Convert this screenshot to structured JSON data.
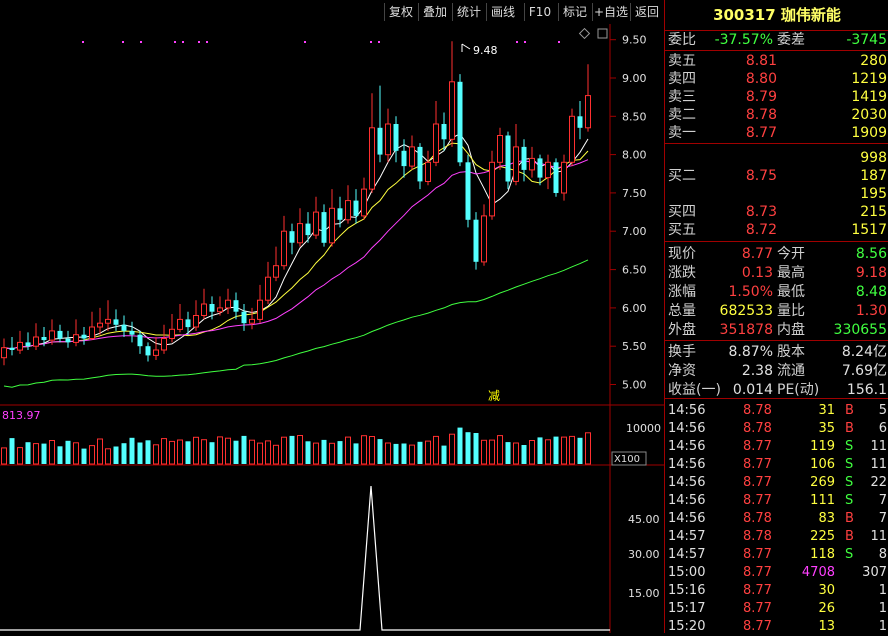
{
  "toolbar": {
    "buttons": [
      "复权",
      "叠加",
      "统计",
      "画线",
      "F10",
      "标记",
      "+自选",
      "返回"
    ]
  },
  "stock": {
    "code": "300317",
    "name": "珈伟新能"
  },
  "quote": {
    "weibi_label": "委比",
    "weibi_value": "-37.57%",
    "weicha_label": "委差",
    "weicha_value": "-3745",
    "sell": [
      {
        "label": "卖五",
        "price": "8.81",
        "vol": "280"
      },
      {
        "label": "卖四",
        "price": "8.80",
        "vol": "1219"
      },
      {
        "label": "卖三",
        "price": "8.79",
        "vol": "1419"
      },
      {
        "label": "卖二",
        "price": "8.78",
        "vol": "2030"
      },
      {
        "label": "卖一",
        "price": "8.77",
        "vol": "1909"
      }
    ],
    "buy": [
      {
        "label": "",
        "price": "",
        "vol": "998"
      },
      {
        "label": "买二",
        "price": "8.75",
        "vol": "187"
      },
      {
        "label": "",
        "price": "",
        "vol": "195"
      },
      {
        "label": "买四",
        "price": "8.73",
        "vol": "215"
      },
      {
        "label": "买五",
        "price": "8.72",
        "vol": "1517"
      }
    ],
    "stats": [
      {
        "l1": "现价",
        "v1": "8.77",
        "l2": "今开",
        "v2": "8.56"
      },
      {
        "l1": "涨跌",
        "v1": "0.13",
        "l2": "最高",
        "v2": "9.18"
      },
      {
        "l1": "涨幅",
        "v1": "1.50%",
        "l2": "最低",
        "v2": "8.48"
      },
      {
        "l1": "总量",
        "v1": "682533",
        "l2": "量比",
        "v2": "1.30"
      },
      {
        "l1": "外盘",
        "v1": "351878",
        "l2": "内盘",
        "v2": "330655"
      }
    ],
    "fund": [
      {
        "l1": "换手",
        "v1": "8.87%",
        "l2": "股本",
        "v2": "8.24亿"
      },
      {
        "l1": "净资",
        "v1": "2.38",
        "l2": "流通",
        "v2": "7.69亿"
      },
      {
        "l1": "收益(一)",
        "v1": "0.014",
        "l2": "PE(动)",
        "v2": "156.1"
      }
    ]
  },
  "ticks": [
    {
      "time": "14:56",
      "price": "8.78",
      "vol": "31",
      "bs": "B",
      "n": "5"
    },
    {
      "time": "14:56",
      "price": "8.78",
      "vol": "35",
      "bs": "B",
      "n": "6"
    },
    {
      "time": "14:56",
      "price": "8.77",
      "vol": "119",
      "bs": "S",
      "n": "11"
    },
    {
      "time": "14:56",
      "price": "8.77",
      "vol": "106",
      "bs": "S",
      "n": "11"
    },
    {
      "time": "14:56",
      "price": "8.77",
      "vol": "269",
      "bs": "S",
      "n": "22"
    },
    {
      "time": "14:56",
      "price": "8.77",
      "vol": "111",
      "bs": "S",
      "n": "7"
    },
    {
      "time": "14:56",
      "price": "8.78",
      "vol": "83",
      "bs": "B",
      "n": "7"
    },
    {
      "time": "14:57",
      "price": "8.78",
      "vol": "225",
      "bs": "B",
      "n": "11"
    },
    {
      "time": "14:57",
      "price": "8.77",
      "vol": "118",
      "bs": "S",
      "n": "8"
    },
    {
      "time": "15:00",
      "price": "8.77",
      "vol": "4708",
      "bs": "",
      "n": "307"
    },
    {
      "time": "15:16",
      "price": "8.77",
      "vol": "30",
      "bs": "",
      "n": "1"
    },
    {
      "time": "15:17",
      "price": "8.77",
      "vol": "26",
      "bs": "",
      "n": "1"
    },
    {
      "time": "15:20",
      "price": "8.77",
      "vol": "13",
      "bs": "",
      "n": "1"
    }
  ],
  "chart_data": {
    "type": "candlestick",
    "price_axis": [
      "9.50",
      "9.00",
      "8.50",
      "8.00",
      "7.50",
      "7.00",
      "6.50",
      "6.00",
      "5.50",
      "5.00"
    ],
    "ylim": [
      4.85,
      9.6
    ],
    "high_marker": "9.48",
    "event_label": "减",
    "volume_label": "813.97",
    "volume_axis": "10000",
    "volume_unit": "X100",
    "indicator_axis": [
      "45.00",
      "30.00",
      "15.00"
    ],
    "candles": [
      [
        5.35,
        5.48,
        5.6,
        5.25
      ],
      [
        5.48,
        5.45,
        5.62,
        5.38
      ],
      [
        5.45,
        5.55,
        5.7,
        5.4
      ],
      [
        5.55,
        5.5,
        5.68,
        5.45
      ],
      [
        5.5,
        5.62,
        5.8,
        5.45
      ],
      [
        5.62,
        5.58,
        5.75,
        5.5
      ],
      [
        5.58,
        5.7,
        5.85,
        5.52
      ],
      [
        5.7,
        5.6,
        5.78,
        5.55
      ],
      [
        5.6,
        5.55,
        5.7,
        5.48
      ],
      [
        5.55,
        5.65,
        5.85,
        5.5
      ],
      [
        5.65,
        5.6,
        5.75,
        5.52
      ],
      [
        5.6,
        5.75,
        5.95,
        5.58
      ],
      [
        5.75,
        5.8,
        6.0,
        5.65
      ],
      [
        5.8,
        5.85,
        6.1,
        5.7
      ],
      [
        5.85,
        5.78,
        5.98,
        5.7
      ],
      [
        5.78,
        5.7,
        5.9,
        5.62
      ],
      [
        5.7,
        5.65,
        5.82,
        5.55
      ],
      [
        5.65,
        5.5,
        5.7,
        5.4
      ],
      [
        5.5,
        5.38,
        5.55,
        5.3
      ],
      [
        5.38,
        5.45,
        5.62,
        5.32
      ],
      [
        5.45,
        5.6,
        5.78,
        5.4
      ],
      [
        5.6,
        5.72,
        5.92,
        5.55
      ],
      [
        5.72,
        5.85,
        6.05,
        5.68
      ],
      [
        5.85,
        5.75,
        5.95,
        5.65
      ],
      [
        5.75,
        5.9,
        6.1,
        5.7
      ],
      [
        5.9,
        6.05,
        6.25,
        5.85
      ],
      [
        6.05,
        5.95,
        6.15,
        5.85
      ],
      [
        5.95,
        6.0,
        6.15,
        5.9
      ],
      [
        6.0,
        6.1,
        6.25,
        5.92
      ],
      [
        6.1,
        5.95,
        6.2,
        5.85
      ],
      [
        5.95,
        5.8,
        6.05,
        5.7
      ],
      [
        5.8,
        5.85,
        6.0,
        5.72
      ],
      [
        5.85,
        6.1,
        6.3,
        5.8
      ],
      [
        6.1,
        6.4,
        6.6,
        6.05
      ],
      [
        6.4,
        6.55,
        6.8,
        6.35
      ],
      [
        6.55,
        7.0,
        7.2,
        6.5
      ],
      [
        7.0,
        6.85,
        7.1,
        6.7
      ],
      [
        6.85,
        7.1,
        7.3,
        6.8
      ],
      [
        7.1,
        6.95,
        7.25,
        6.85
      ],
      [
        6.95,
        7.25,
        7.45,
        6.9
      ],
      [
        7.25,
        6.85,
        7.35,
        6.8
      ],
      [
        6.85,
        7.3,
        7.55,
        6.8
      ],
      [
        7.3,
        7.15,
        7.45,
        7.05
      ],
      [
        7.15,
        7.4,
        7.6,
        7.1
      ],
      [
        7.4,
        7.2,
        7.55,
        7.1
      ],
      [
        7.2,
        7.55,
        7.7,
        7.15
      ],
      [
        7.55,
        8.35,
        8.8,
        7.5
      ],
      [
        8.35,
        8.0,
        8.9,
        7.9
      ],
      [
        8.0,
        8.4,
        8.6,
        7.9
      ],
      [
        8.4,
        8.05,
        8.5,
        7.9
      ],
      [
        8.05,
        7.85,
        8.2,
        7.7
      ],
      [
        7.85,
        8.1,
        8.25,
        7.8
      ],
      [
        8.1,
        7.65,
        8.15,
        7.55
      ],
      [
        7.65,
        7.9,
        8.05,
        7.6
      ],
      [
        7.9,
        8.4,
        8.7,
        7.85
      ],
      [
        8.4,
        8.2,
        8.55,
        8.05
      ],
      [
        8.2,
        8.95,
        9.48,
        8.1
      ],
      [
        8.95,
        7.9,
        9.05,
        7.85
      ],
      [
        7.9,
        7.15,
        8.0,
        7.05
      ],
      [
        7.15,
        6.6,
        7.25,
        6.5
      ],
      [
        6.6,
        7.2,
        7.35,
        6.55
      ],
      [
        7.2,
        7.9,
        8.05,
        7.15
      ],
      [
        7.9,
        8.25,
        8.35,
        7.8
      ],
      [
        8.25,
        7.65,
        8.3,
        7.55
      ],
      [
        7.65,
        8.1,
        8.4,
        7.6
      ],
      [
        8.1,
        7.8,
        8.2,
        7.65
      ],
      [
        7.8,
        7.95,
        8.1,
        7.7
      ],
      [
        7.95,
        7.7,
        8.0,
        7.6
      ],
      [
        7.7,
        7.9,
        8.0,
        7.55
      ],
      [
        7.9,
        7.5,
        7.95,
        7.45
      ],
      [
        7.5,
        7.9,
        8.0,
        7.4
      ],
      [
        7.9,
        8.5,
        8.6,
        7.85
      ],
      [
        8.5,
        8.35,
        8.7,
        8.2
      ],
      [
        8.35,
        8.77,
        9.18,
        8.3
      ]
    ]
  }
}
